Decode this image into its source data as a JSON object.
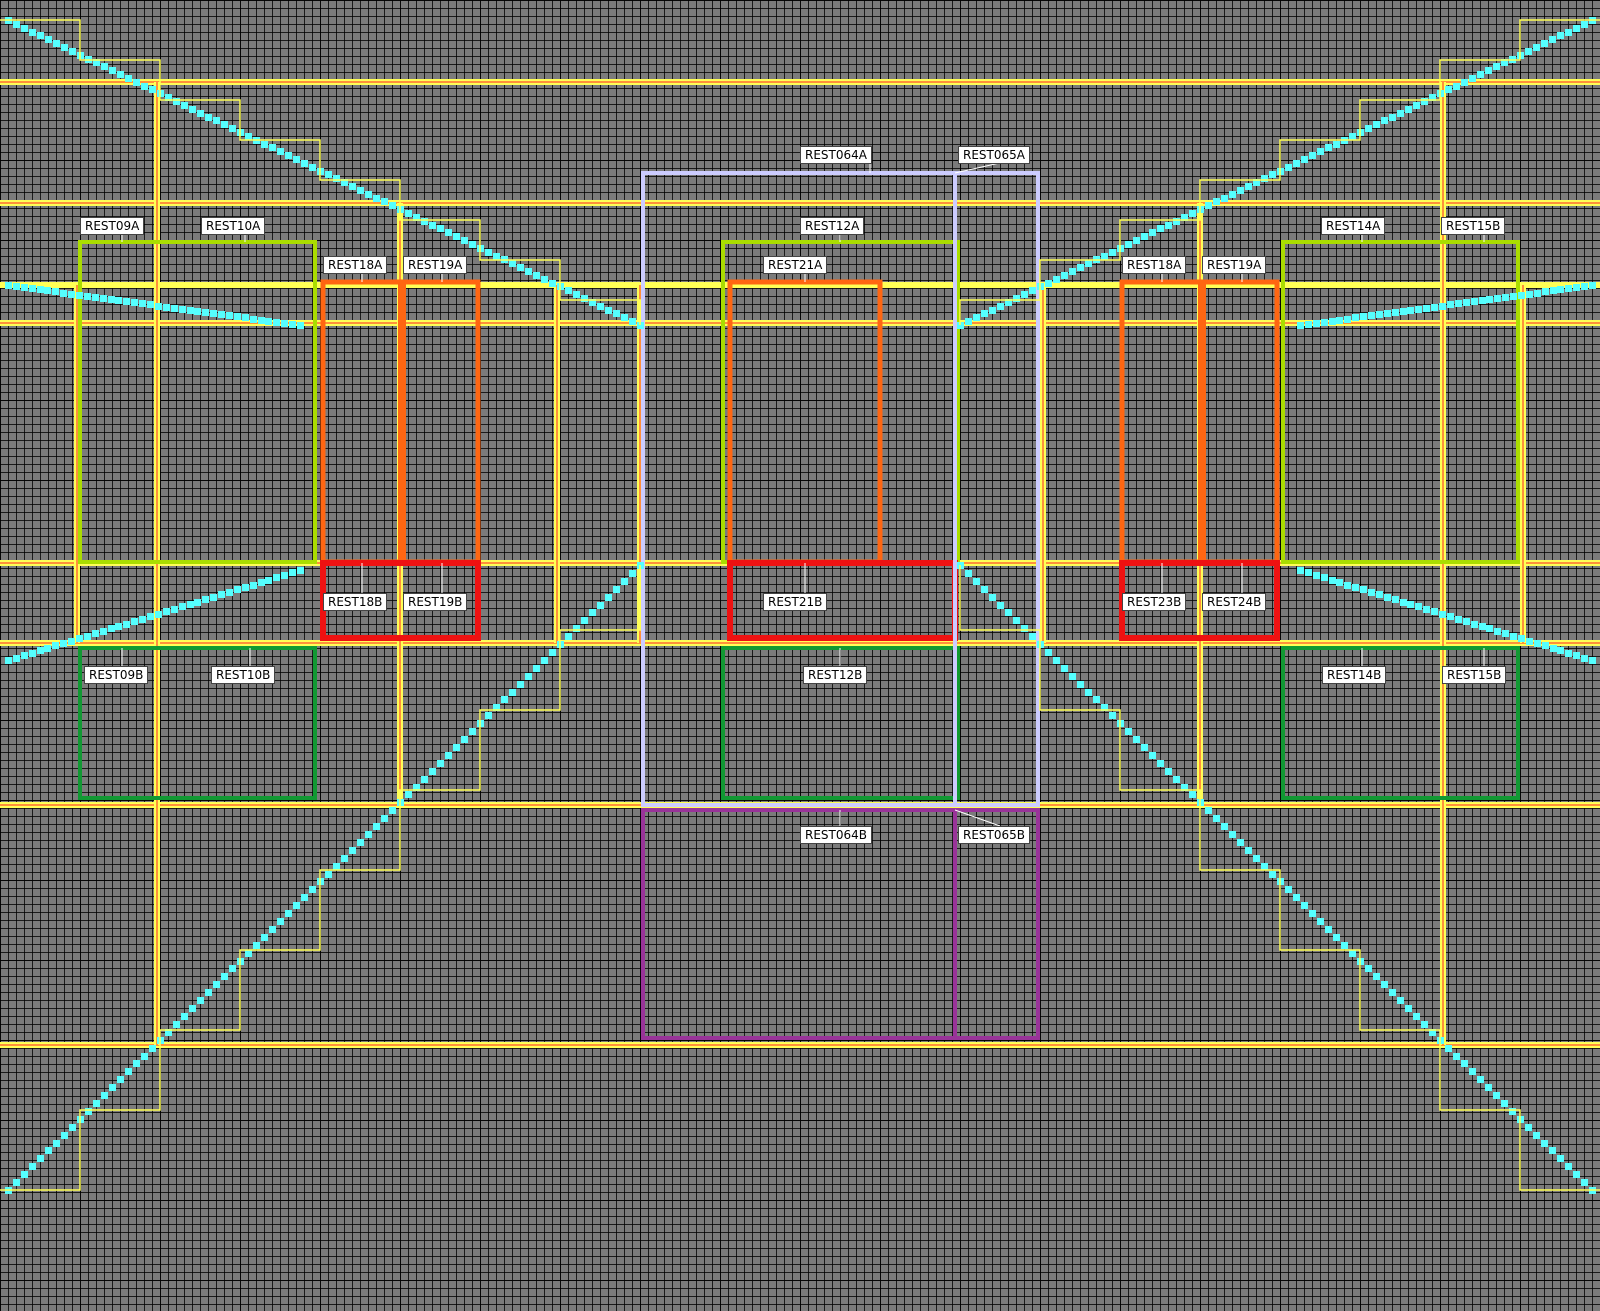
{
  "labels": {
    "rest064a": "REST064A",
    "rest065a": "REST065A",
    "rest09a": "REST09A",
    "rest10a": "REST10A",
    "rest12a": "REST12A",
    "rest14a": "REST14A",
    "rest15b_top": "REST15B",
    "rest18a_left": "REST18A",
    "rest19a_left": "REST19A",
    "rest21a": "REST21A",
    "rest18a_right": "REST18A",
    "rest19a_right": "REST19A",
    "rest18b": "REST18B",
    "rest19b": "REST19B",
    "rest21b": "REST21B",
    "rest23b": "REST23B",
    "rest24b": "REST24B",
    "rest09b": "REST09B",
    "rest10b": "REST10B",
    "rest12b": "REST12B",
    "rest14b": "REST14B",
    "rest15b_bottom": "REST15B",
    "rest064b": "REST064B",
    "rest065b": "REST065B"
  },
  "colors": {
    "background": "#7b7b7b",
    "grid": "#000000",
    "highway": "#ffff55",
    "highway_edge": "#ff2222",
    "route": "#55ffff",
    "zone_lime": "#aadd00",
    "zone_green": "#119933",
    "zone_orange": "#ff6611",
    "zone_red": "#ee1111",
    "zone_lavender": "#ccccff",
    "zone_purple": "#993399",
    "label_bg": "#ffffff"
  }
}
